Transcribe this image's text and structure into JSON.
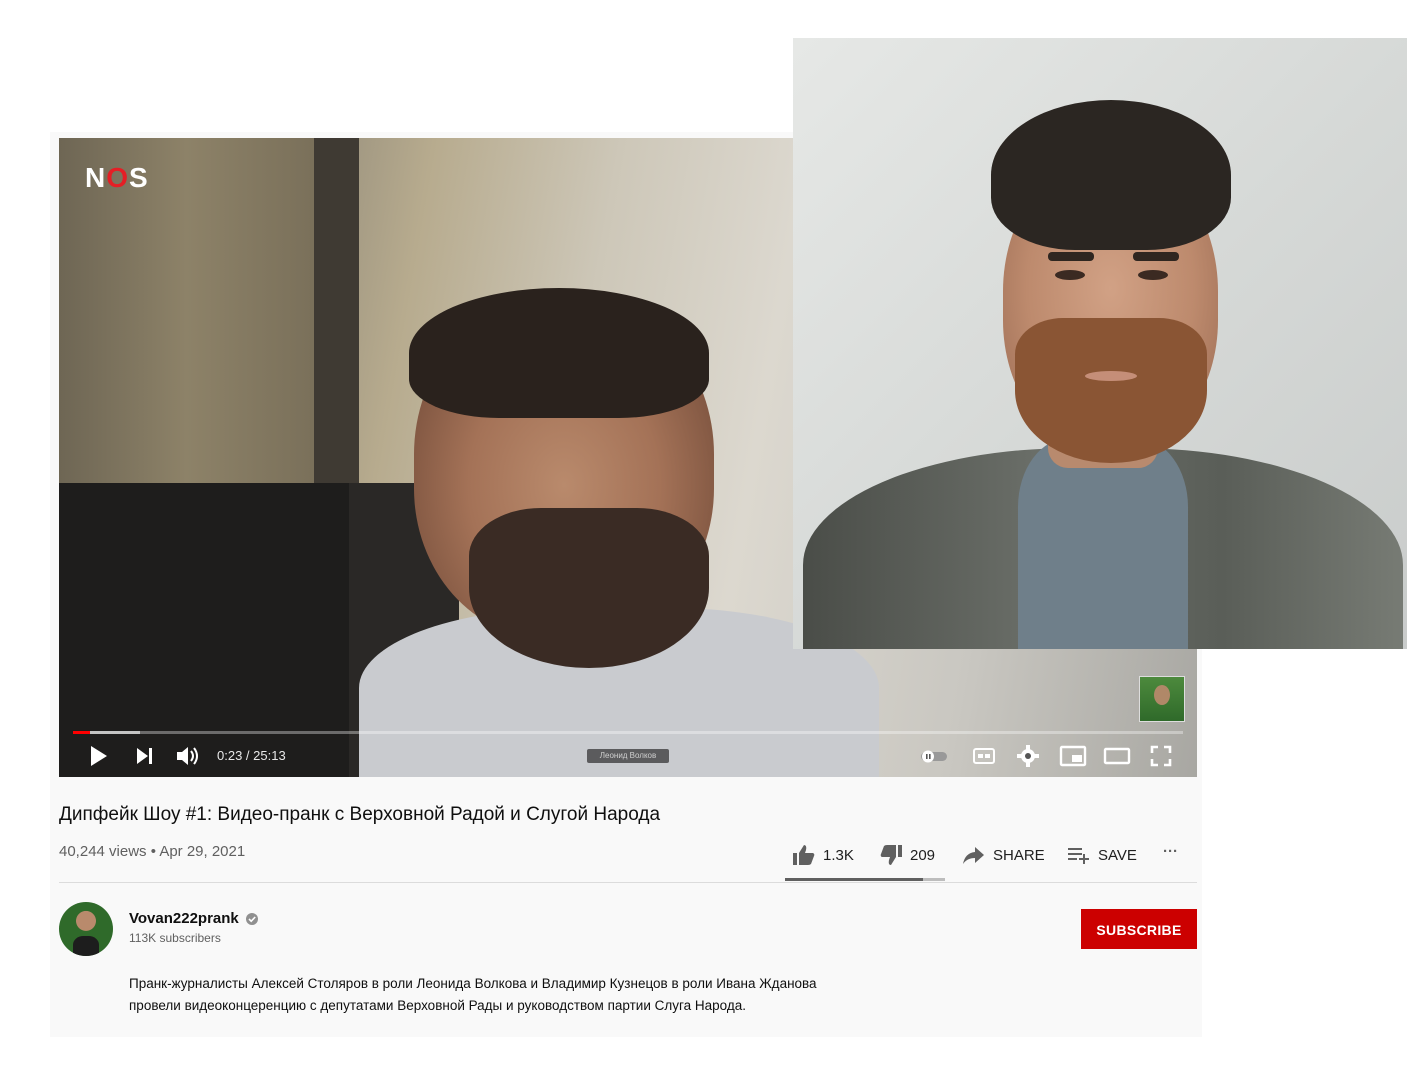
{
  "player": {
    "watermark_pre": "N",
    "watermark_o": "O",
    "watermark_post": "S",
    "time": "0:23 / 25:13",
    "chapter_label": "Леонид Волков",
    "progress_played_fraction": 0.015,
    "icons": [
      "play-icon",
      "next-icon",
      "volume-icon",
      "autoplay-toggle-icon",
      "subtitles-icon",
      "settings-icon",
      "miniplayer-icon",
      "theater-mode-icon",
      "fullscreen-icon"
    ]
  },
  "video": {
    "title": "Дипфейк Шоу #1: Видео-пранк с Верховной Радой и Слугой Народа",
    "views_date": "40,244 views • Apr 29, 2021",
    "like_count": "1.3K",
    "dislike_count": "209",
    "share_label": "SHARE",
    "save_label": "SAVE",
    "more_label": "···",
    "like_ratio": 0.86
  },
  "channel": {
    "name": "Vovan222prank",
    "subscribers": "113K subscribers",
    "subscribe_label": "SUBSCRIBE",
    "verified": true
  },
  "description": "Пранк-журналисты Алексей Столяров в роли Леонида Волкова и Владимир Кузнецов в роли Ивана Жданова провели видеоконцеренцию с депутатами Верховной Рады и руководством партии Слуга Народа.",
  "colors": {
    "subscribe_red": "#cc0000",
    "progress_red": "#ff0000",
    "nos_red": "#e51e25"
  }
}
